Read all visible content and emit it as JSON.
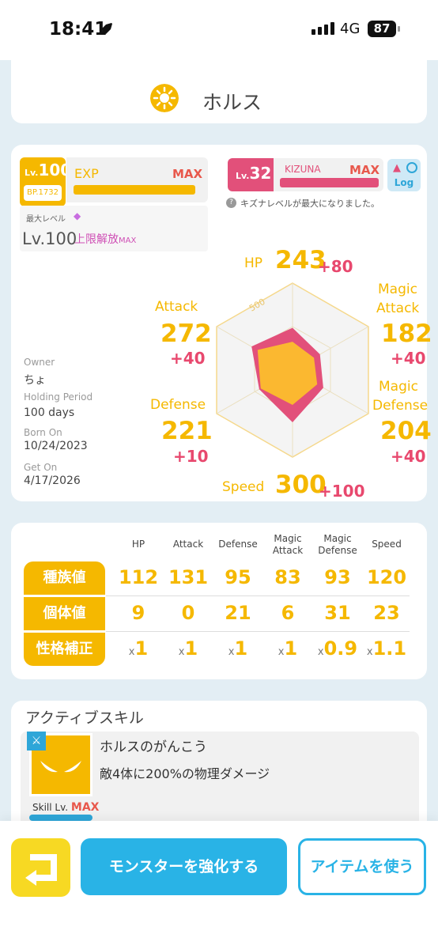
{
  "status_bar": {
    "time": "18:41",
    "network": "4G",
    "battery": "87"
  },
  "monster": {
    "name": "ホルス"
  },
  "level": {
    "lv_prefix": "Lv.",
    "lv_value": "100",
    "bp": "BP.1732",
    "exp_label": "EXP",
    "exp_max": "MAX",
    "exp_progress": 1.0,
    "max_level_label": "最大レベル",
    "max_level": "Lv.100",
    "unlock_label": "上限解放",
    "unlock_suffix": "MAX"
  },
  "kizuna": {
    "lv_prefix": "Lv.",
    "lv_value": "32",
    "label": "KIZUNA",
    "max": "MAX",
    "progress": 1.0,
    "log_label": "Log",
    "message": "キズナレベルが最大になりました。"
  },
  "owner_info": {
    "owner_label": "Owner",
    "owner": "ちょ",
    "holding_label": "Holding Period",
    "holding": "100 days",
    "born_label": "Born On",
    "born": "10/24/2023",
    "get_label": "Get On",
    "get": "4/17/2026"
  },
  "stats": {
    "hp": {
      "label": "HP",
      "value": "243",
      "bonus": "+80"
    },
    "attack": {
      "label": "Attack",
      "value": "272",
      "bonus": "+40"
    },
    "magic_attack": {
      "label1": "Magic",
      "label2": "Attack",
      "value": "182",
      "bonus": "+40"
    },
    "defense": {
      "label": "Defense",
      "value": "221",
      "bonus": "+10"
    },
    "magic_defense": {
      "label1": "Magic",
      "label2": "Defense",
      "value": "204",
      "bonus": "+40"
    },
    "speed": {
      "label": "Speed",
      "value": "300",
      "bonus": "+100"
    },
    "radar_max_label": "500",
    "radar_max": 500
  },
  "table": {
    "headers": [
      "HP",
      "Attack",
      "Defense",
      "Magic Attack",
      "Magic Defense",
      "Speed"
    ],
    "rows": [
      {
        "label": "種族値",
        "values": [
          "112",
          "131",
          "95",
          "83",
          "93",
          "120"
        ]
      },
      {
        "label": "個体値",
        "values": [
          "9",
          "0",
          "21",
          "6",
          "31",
          "23"
        ]
      },
      {
        "label": "性格補正",
        "values": [
          "1",
          "1",
          "1",
          "1",
          "0.9",
          "1.1"
        ],
        "prefix": "x"
      }
    ]
  },
  "skill": {
    "section_title": "アクティブスキル",
    "name": "ホルスのがんこう",
    "description": "敵4体に200%の物理ダメージ",
    "level_label": "Skill Lv.",
    "level_value": "MAX"
  },
  "buttons": {
    "enhance": "モンスターを強化する",
    "use_item": "アイテムを使う"
  },
  "colors": {
    "yellow": "#f5b800",
    "pink": "#e2507a",
    "blue": "#29b3e6"
  }
}
